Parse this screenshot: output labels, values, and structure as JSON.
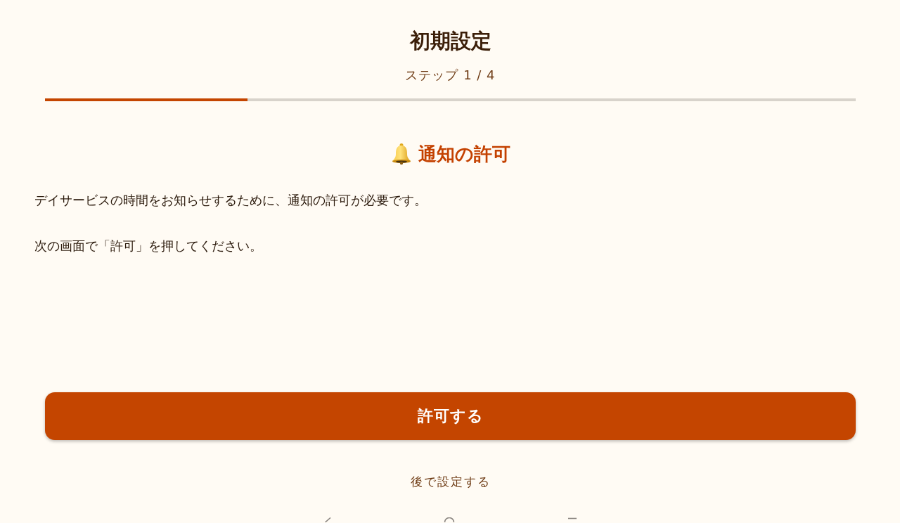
{
  "header": {
    "title": "初期設定",
    "step": "ステップ 1 / 4"
  },
  "progress": {
    "level": 0.25
  },
  "section": {
    "title": "通知の許可",
    "paragraphs": [
      "デイサービスの時間をお知らせするために、通知の許可が必要です。",
      "次の画面で「許可」を押してください。"
    ]
  },
  "primary_button": {
    "label": "許可する"
  },
  "secondary_link": {
    "label": "後で設定する"
  }
}
